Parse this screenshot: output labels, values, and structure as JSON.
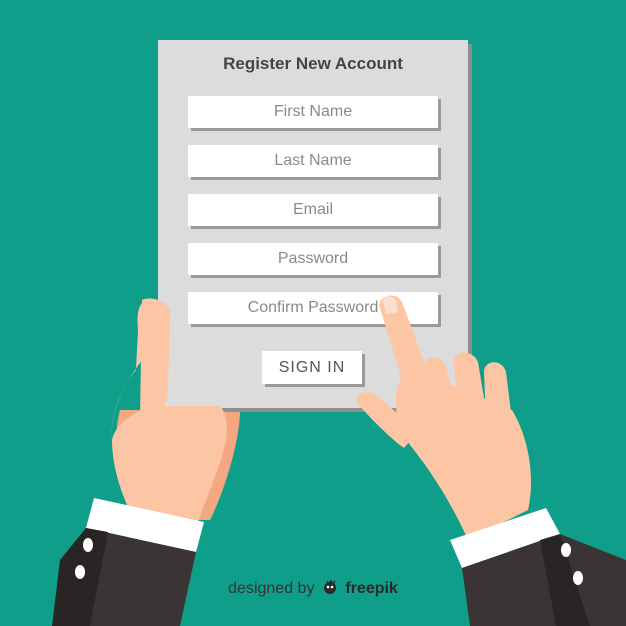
{
  "form": {
    "title": "Register New Account",
    "fields": [
      {
        "placeholder": "First Name"
      },
      {
        "placeholder": "Last Name"
      },
      {
        "placeholder": "Email"
      },
      {
        "placeholder": "Password"
      },
      {
        "placeholder": "Confirm Password"
      }
    ],
    "submit_label": "SIGN IN"
  },
  "credit": {
    "prefix": "designed by",
    "brand": "freepik",
    "logo_icon": "freepik-logo-icon"
  },
  "colors": {
    "background": "#0f9e8a",
    "card": "#dcdcdc",
    "sleeve": "#2e2a2a",
    "skin": "#fcc5a3"
  }
}
